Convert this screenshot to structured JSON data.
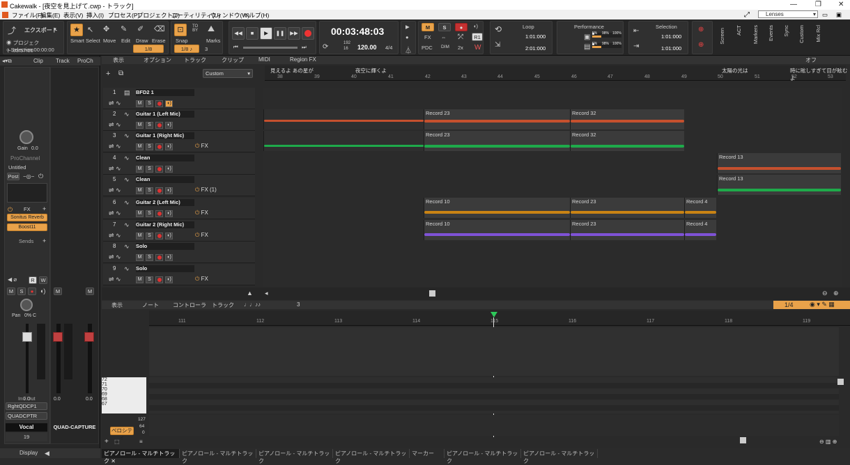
{
  "window": {
    "title": "Cakewalk - [夜空を見上げて.cwp - トラック]"
  },
  "menu": [
    "ファイル(F)",
    "編集(E)",
    "表示(V)",
    "挿入(I)",
    "プロセス(P)",
    "プロジェクト(J)",
    "ユーティリティ(U)",
    "ウィンドウ(W)",
    "ヘルプ(H)"
  ],
  "lenses": "Lenses",
  "controlbar": {
    "export": "エクスポート",
    "project_time": "プロジェクト:03:57:00",
    "selection_time": "Selection:00:00:00",
    "tools": [
      "Smart",
      "Select",
      "Move",
      "Edit",
      "Draw",
      "Erase"
    ],
    "tool_fraction": "1/8",
    "snap_label": "Snap",
    "snap_value": "1/8",
    "snap_num": "3",
    "marks_label": "Marks",
    "time": "00:03:48:03",
    "ppq_top": "192",
    "ppq_bottom": "16",
    "tempo": "120.00",
    "meter": "4/4",
    "mix_m": "M",
    "mix_s": "S",
    "mix_fx": "FX",
    "mix_pdc": "PDC",
    "mix_dim": "DIM",
    "mix_2x": "2x",
    "mix_r1": "R1",
    "loop_label": "Loop",
    "loop_start": "1:01:000",
    "loop_end": "2:01:000",
    "performance_label": "Performance",
    "perf_pct": [
      "5%",
      "98%",
      "100%",
      "5%",
      "98%",
      "100%"
    ],
    "selection_label": "Selection",
    "sel_start": "1:01:000",
    "sel_end": "1:01:000",
    "side_labels": [
      "Screen",
      "ACT",
      "Markers",
      "Events",
      "Sync",
      "Custom",
      "Mix Rcl"
    ]
  },
  "inspector": {
    "tabs": [
      "Clip",
      "Track",
      "ProCh"
    ],
    "gain_label": "Gain",
    "gain_value": "0.0",
    "prochannel": "ProChannel",
    "preset": "Untitled",
    "post": "Post",
    "fx_label": "FX",
    "fx": [
      "Sonitus Reverb",
      "Boost11"
    ],
    "sends_label": "Sends",
    "rw": [
      "R",
      "W"
    ],
    "pan_label": "Pan",
    "pan_value": "0% C",
    "fader_scale": [
      "6",
      "0",
      "-6",
      "-12",
      "-18",
      "-24",
      "-36",
      "-60"
    ],
    "meter_scale": [
      "-3",
      "-6",
      "-9",
      "-12",
      "-15",
      "-18",
      "-21",
      "-24",
      "-27",
      "-30",
      "-33",
      "-36",
      "-42",
      "-48",
      "-54"
    ],
    "val1": "0.0",
    "val2": "0.0",
    "val3": "0.0",
    "inout": "In / Out",
    "input": "RghtQDCP1",
    "output": "QUADCPTR",
    "strip_name": "Vocal",
    "strip_name2": "QUAD-CAPTURE",
    "strip_num": "19",
    "display": "Display"
  },
  "track_menubar": {
    "items": [
      "表示",
      "オプション",
      "トラック",
      "クリップ",
      "MIDI",
      "Region FX"
    ],
    "custom": "Custom",
    "off": "オフ"
  },
  "timeline": {
    "markers": [
      {
        "label": "見えるよ あの星が",
        "bar": "38"
      },
      {
        "label": "夜空に輝くよ",
        "bar": "40"
      },
      {
        "label": "太陽の光は",
        "bar": "50"
      },
      {
        "label": "時に眩しすぎて目が眩むよ",
        "bar": "52"
      }
    ],
    "bars": [
      "38",
      "39",
      "40",
      "41",
      "42",
      "43",
      "44",
      "45",
      "46",
      "47",
      "48",
      "49",
      "50",
      "51",
      "52",
      "53"
    ]
  },
  "tracks": [
    {
      "num": "1",
      "name": "BFD2 1",
      "fx": ""
    },
    {
      "num": "2",
      "name": "Guitar 1 (Left Mic)",
      "fx": ""
    },
    {
      "num": "3",
      "name": "Guitar 1 (Right Mic)",
      "fx": "FX"
    },
    {
      "num": "4",
      "name": "Clean",
      "fx": ""
    },
    {
      "num": "5",
      "name": "Clean",
      "fx": "FX (1)"
    },
    {
      "num": "6",
      "name": "Guitar 2 (Left Mic)",
      "fx": "FX"
    },
    {
      "num": "7",
      "name": "Guitar 2 (Right Mic)",
      "fx": "FX"
    },
    {
      "num": "8",
      "name": "Solo",
      "fx": ""
    },
    {
      "num": "9",
      "name": "Solo",
      "fx": "FX"
    }
  ],
  "track_buttons": {
    "m": "M",
    "s": "S"
  },
  "clips": {
    "t2a": "Record 23",
    "t2b": "Record 32",
    "t3a": "Record 23",
    "t3b": "Record 32",
    "t4": "Record 13",
    "t5": "Record 13",
    "t6a": "Record 10",
    "t6b": "Record 23",
    "t6c": "Record 4",
    "t7a": "Record 10",
    "t7b": "Record 23",
    "t7c": "Record 4"
  },
  "colors": {
    "red": "#c5502e",
    "green": "#1eaa4a",
    "orange": "#c98314",
    "purple": "#7f52d6",
    "accent": "#e9a24a"
  },
  "pianoroll": {
    "menu": [
      "表示",
      "ノート",
      "コントローラ",
      "トラック"
    ],
    "snap_num": "3",
    "snap": "1/4",
    "bars": [
      "111",
      "112",
      "113",
      "114",
      "115",
      "116",
      "117",
      "118",
      "119"
    ],
    "keys": [
      "72",
      "71",
      "70",
      "69",
      "68",
      "67"
    ],
    "velocity": "ベロシティ",
    "vel_scale": [
      "127",
      "64",
      "0"
    ]
  },
  "bottom_tabs": [
    "ピアノロール - マルチトラック",
    "ピアノロール - マルチトラック",
    "ピアノロール - マルチトラック",
    "ピアノロール - マルチトラック",
    "マーカー",
    "ピアノロール - マルチトラック",
    "ピアノロール - マルチトラック"
  ]
}
